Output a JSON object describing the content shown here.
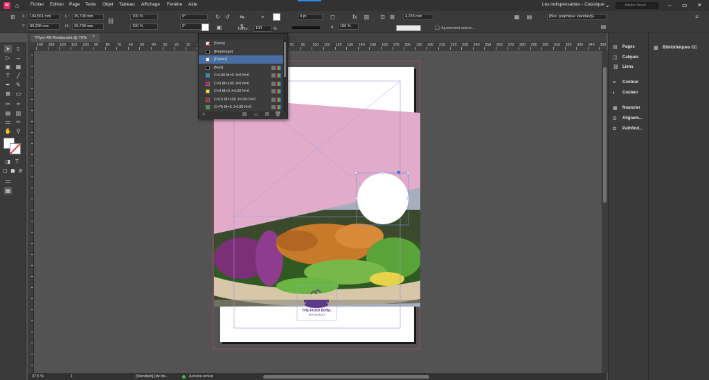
{
  "app": {
    "logo": "Id"
  },
  "menu": [
    "Fichier",
    "Edition",
    "Page",
    "Texte",
    "Objet",
    "Tableau",
    "Affichage",
    "Fenêtre",
    "Aide"
  ],
  "workspace": "Les indispensables - Classique",
  "search_placeholder": "Adobe Stock",
  "control": {
    "x": "194,561 mm",
    "y": "80,298 mm",
    "w": "39,708 mm",
    "h": "39,708 mm",
    "scale_x": "100 %",
    "scale_y": "100 %",
    "rot": "0°",
    "shear": "0°",
    "stroke": "0 pt",
    "teinte_label": "Teinte :",
    "teinte": "100",
    "opacity": "100 %",
    "stroke_w": "4,233 mm",
    "style": "[Bloc graphique standard]+",
    "autofit": "Ajustement autom..."
  },
  "document": {
    "tab": "*Flyer-A5-Restaurant @ 75%"
  },
  "ruler_h": [
    "140",
    "130",
    "120",
    "110",
    "100",
    "90",
    "80",
    "70",
    "60",
    "50",
    "40",
    "30",
    "20",
    "10",
    "0",
    "10",
    "20",
    "30",
    "40",
    "50",
    "60",
    "70",
    "80",
    "90",
    "100",
    "110",
    "120",
    "130",
    "140",
    "150",
    "160",
    "170",
    "180",
    "190",
    "200",
    "210",
    "220",
    "230",
    "240",
    "250",
    "260",
    "270",
    "280",
    "290",
    "300",
    "310",
    "320",
    "330",
    "340",
    "350",
    "360"
  ],
  "swatches": [
    {
      "name": "[Sans]",
      "color": "none"
    },
    {
      "name": "[Repérage]",
      "color": "#000000"
    },
    {
      "name": "[Papier]",
      "color": "#ffffff",
      "selected": true
    },
    {
      "name": "[Noir]",
      "color": "#000000"
    },
    {
      "name": "C=100 M=0 J=0 N=0",
      "color": "#009fe3"
    },
    {
      "name": "C=0 M=100 J=0 N=0",
      "color": "#e5007d"
    },
    {
      "name": "C=0 M=0 J=100 N=0",
      "color": "#ffed00"
    },
    {
      "name": "C=15 M=100 J=100 N=0",
      "color": "#c8171d"
    },
    {
      "name": "C=75 M=5 J=100 N=0",
      "color": "#3aa935"
    }
  ],
  "flyer": {
    "brand": "THE FOOD BOWL",
    "sub": "RESTAURANT",
    "pink": "#e2abc9",
    "purple": "#5b3a8c"
  },
  "panels": [
    "Pages",
    "Calques",
    "Liens",
    "Contour",
    "Couleur",
    "Nuancier",
    "Alignem...",
    "Pathfind..."
  ],
  "cc_panel": "Bibliothèques CC",
  "status": {
    "zoom": "37,5 %",
    "page": "1",
    "preset": "[Standard] (de tra...",
    "errors": "Aucune erreur"
  }
}
